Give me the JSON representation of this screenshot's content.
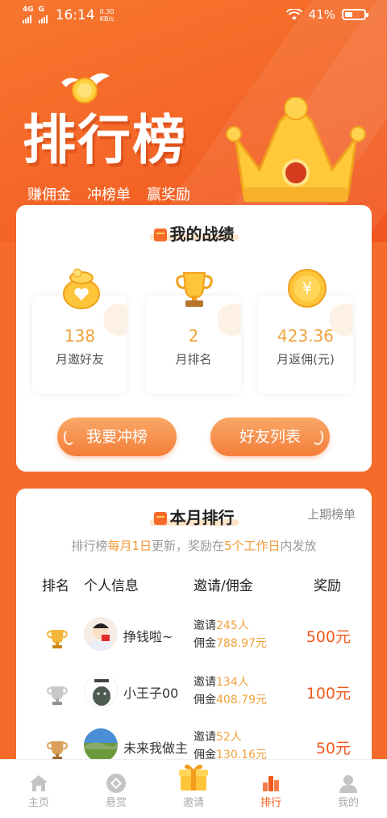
{
  "status_bar": {
    "network": "4G",
    "network2": "G",
    "time": "16:14",
    "speed_value": "0.30",
    "speed_unit": "KB/s",
    "battery": "41%",
    "battery_level": 0.41
  },
  "hero": {
    "title": "排行榜",
    "tags": [
      "赚佣金",
      "冲榜单",
      "赢奖励"
    ]
  },
  "my_record": {
    "title": "我的战绩",
    "stats": [
      {
        "value": "138",
        "label": "月邀好友",
        "icon": "money-bag-icon"
      },
      {
        "value": "2",
        "label": "月排名",
        "icon": "trophy-icon"
      },
      {
        "value": "423.36",
        "label": "月返佣(元)",
        "icon": "yuan-coin-icon"
      }
    ],
    "buttons": [
      "我要冲榜",
      "好友列表"
    ]
  },
  "ranking": {
    "title": "本月排行",
    "last_month_link": "上期榜单",
    "notice_parts": [
      "排行榜",
      "每月1日",
      "更新，奖励在",
      "5个工作日",
      "内发放"
    ],
    "headers": {
      "rank": "排名",
      "info": "个人信息",
      "invite": "邀请/佣金",
      "reward": "奖励"
    },
    "rows": [
      {
        "medal": "gold",
        "name": "挣钱啦~",
        "invite_label": "邀请",
        "invite": "245人",
        "commission_label": "佣金",
        "commission": "788.97元",
        "reward": "500元"
      },
      {
        "medal": "silver",
        "name": "小王子00",
        "invite_label": "邀请",
        "invite": "134人",
        "commission_label": "佣金",
        "commission": "408.79元",
        "reward": "100元"
      },
      {
        "medal": "bronze",
        "name": "未来我做主",
        "invite_label": "邀请",
        "invite": "52人",
        "commission_label": "佣金",
        "commission": "130.16元",
        "reward": "50元"
      }
    ]
  },
  "tabbar": {
    "tabs": [
      {
        "label": "主页",
        "icon": "home-icon"
      },
      {
        "label": "悬赏",
        "icon": "bounty-icon"
      },
      {
        "label": "邀请",
        "icon": "gift-icon"
      },
      {
        "label": "排行",
        "icon": "ranking-icon"
      },
      {
        "label": "我的",
        "icon": "profile-icon"
      }
    ],
    "active": "排行"
  },
  "colors": {
    "accent": "#f46b2a",
    "gold_text": "#f0a23c",
    "reward_text": "#f05a1c"
  }
}
